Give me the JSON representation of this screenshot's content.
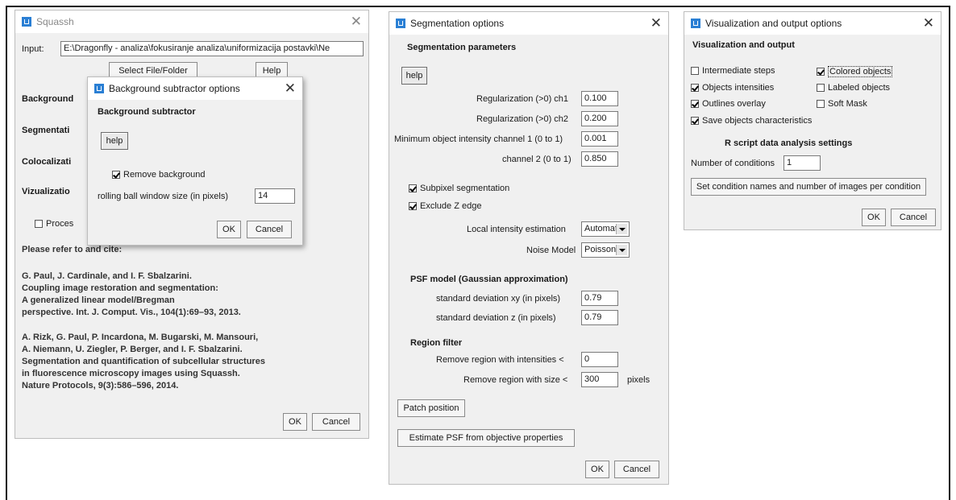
{
  "squassh": {
    "title": "Squassh",
    "input_label": "Input:",
    "input_value": "E:\\Dragonfly - analiza\\fokusiranje analiza\\uniformizacija postavki\\Ne",
    "select_button": "Select File/Folder",
    "help_button": "Help",
    "sections": [
      "Background",
      "Segmentati",
      "Colocalizati",
      "Vizualizatio"
    ],
    "process_label": "Proces",
    "refer_text": "Please refer to and cite:",
    "citation1": "G. Paul, J. Cardinale, and I. F. Sbalzarini.\nCoupling image restoration and segmentation:\nA generalized linear model/Bregman\nperspective. Int. J. Comput. Vis., 104(1):69–93, 2013.",
    "citation2": "A. Rizk, G. Paul, P. Incardona, M. Bugarski, M. Mansouri,\nA. Niemann, U. Ziegler, P. Berger, and I. F. Sbalzarini.\nSegmentation and quantification of subcellular structures\nin fluorescence microscopy images using Squassh.\nNature Protocols, 9(3):586–596, 2014.",
    "ok": "OK",
    "cancel": "Cancel"
  },
  "bg_dialog": {
    "title": "Background subtractor options",
    "heading": "Background subtractor",
    "help": "help",
    "remove_bg_label": "Remove background",
    "remove_bg_checked": true,
    "rolling_label": "rolling ball window size (in pixels)",
    "rolling_value": "14",
    "ok": "OK",
    "cancel": "Cancel"
  },
  "seg": {
    "title": "Segmentation options",
    "heading": "Segmentation parameters",
    "help": "help",
    "reg1_label": "Regularization (>0) ch1",
    "reg1_value": "0.100",
    "reg2_label": "Regularization (>0) ch2",
    "reg2_value": "0.200",
    "min1_label": "Minimum object intensity channel 1 (0 to 1)",
    "min1_value": "0.001",
    "min2_label": "channel 2 (0 to 1)",
    "min2_value": "0.850",
    "subpixel_label": "Subpixel segmentation",
    "excludez_label": "Exclude Z edge",
    "local_label": "Local intensity estimation",
    "local_value": "Automatic",
    "noise_label": "Noise Model",
    "noise_value": "Poisson",
    "psf_heading": "PSF model (Gaussian approximation)",
    "sdxy_label": "standard deviation xy (in pixels)",
    "sdxy_value": "0.79",
    "sdz_label": "standard deviation z  (in pixels)",
    "sdz_value": "0.79",
    "region_heading": "Region filter",
    "rint_label": "Remove region with intensities <",
    "rint_value": "0",
    "rsize_label": "Remove region with size <",
    "rsize_value": "300",
    "rsize_unit": "pixels",
    "patch_button": "Patch position",
    "estimate_button": "Estimate PSF from objective properties",
    "ok": "OK",
    "cancel": "Cancel"
  },
  "vis": {
    "title": "Visualization and output options",
    "heading": "Visualization and output",
    "intermediate": "Intermediate steps",
    "colored": "Colored objects",
    "intensities": "Objects intensities",
    "labeled": "Labeled objects",
    "outlines": "Outlines overlay",
    "softmask": "Soft Mask",
    "save_chars": "Save objects characteristics",
    "r_heading": "R script data analysis settings",
    "numcond_label": "Number of conditions",
    "numcond_value": "1",
    "setcond_button": "Set condition names and number of images per condition",
    "ok": "OK",
    "cancel": "Cancel"
  },
  "colors": {
    "title_icon": "#2a7fd4",
    "window_bg": "#f0f0f0"
  }
}
